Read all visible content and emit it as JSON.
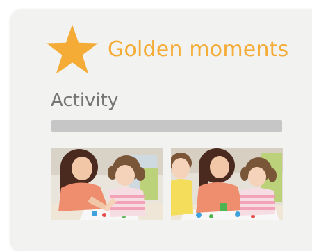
{
  "header": {
    "icon": "star-icon",
    "title": "Golden moments"
  },
  "activity": {
    "label": "Activity",
    "progress": 0
  },
  "photos": [
    {
      "icon": "photo-mother-daughter-painting"
    },
    {
      "icon": "photo-mother-two-children-painting"
    }
  ],
  "colors": {
    "accent": "#f4ac37",
    "label_text": "#757575",
    "card_background": "#f2f2f1",
    "progress_track": "#c6c6c6"
  }
}
